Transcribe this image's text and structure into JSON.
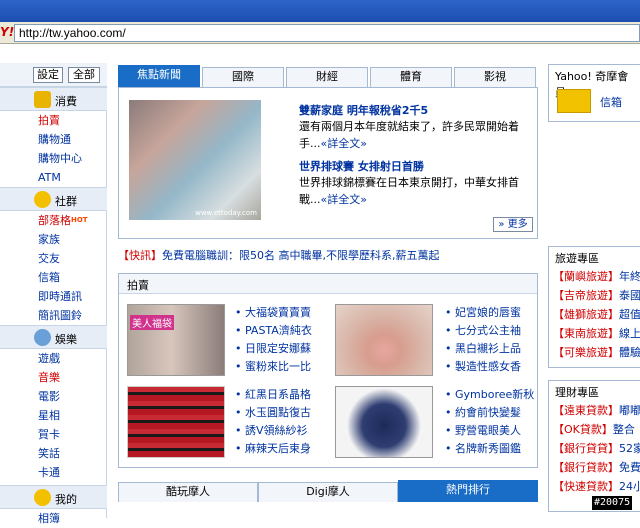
{
  "browser": {
    "logo": "Y!",
    "url": "http://tw.yahoo.com/"
  },
  "sidebar": {
    "settings_label": "設定",
    "all_label": "全部",
    "categories": [
      {
        "title": "消費",
        "items": [
          "拍賣",
          "購物通",
          "購物中心",
          "ATM"
        ]
      },
      {
        "title": "社群",
        "items": [
          "部落格",
          "家族",
          "交友",
          "信箱",
          "即時通訊",
          "簡訊圖鈴"
        ],
        "hot": "HOT"
      },
      {
        "title": "娛樂",
        "items": [
          "遊戲",
          "音樂",
          "電影",
          "星相",
          "賀卡",
          "笑話",
          "卡通"
        ]
      },
      {
        "title": "我的",
        "items": [
          "相簿"
        ]
      }
    ]
  },
  "tabs": [
    "焦點新聞",
    "國際",
    "財經",
    "體育",
    "影視"
  ],
  "news": {
    "image_caption": "www.ettoday.com",
    "items": [
      {
        "title": "雙薪家庭 明年報稅省2千5",
        "summary": "還有兩個月本年度就結束了，許多民眾開始着手...",
        "more": "«詳全文»"
      },
      {
        "title": "世界排球賽 女排射日首勝",
        "summary": "世界排球錦標賽在日本東京開打，中華女排首戰...",
        "more": "«詳全文»"
      }
    ],
    "more_button": "» 更多"
  },
  "ticker": {
    "tag": "【快訊】",
    "text": "免費電腦職訓：限50名 高中職畢,不限學歷科系,薪五萬起"
  },
  "auction": {
    "title": "拍賣",
    "banner_text": "美人福袋",
    "groups": [
      [
        "大福袋賣賣賣",
        "PASTA濟純衣",
        "日限定安娜蘇",
        "蜜粉來比一比"
      ],
      [
        "妃宮娘的唇蜜",
        "七分式公主袖",
        "黑白襯衫上品",
        "製造性感女香"
      ],
      [
        "紅黑日系晶格",
        "水玉圓點復古",
        "誘V領絲紗衫",
        "麻辣天后束身"
      ],
      [
        "Gymboree新秋",
        "約會前快變髮",
        "野營電眼美人",
        "名牌新秀圖鑑"
      ]
    ]
  },
  "bottom_tabs": [
    "酷玩摩人",
    "Digi摩人",
    "熱門排行"
  ],
  "right": {
    "member_title": "Yahoo! 奇摩會員",
    "mail_label": "信箱",
    "travel_title": "旅遊專區",
    "travel_items": [
      {
        "tag": "【蘭嶼旅遊】",
        "text": "年終"
      },
      {
        "tag": "【吉帝旅遊】",
        "text": "泰國"
      },
      {
        "tag": "【雄獅旅遊】",
        "text": "超值"
      },
      {
        "tag": "【東南旅遊】",
        "text": "線上"
      },
      {
        "tag": "【可樂旅遊】",
        "text": "體驗"
      }
    ],
    "finance_title": "理財專區",
    "finance_items": [
      {
        "tag": "【遠東貸款】",
        "text": "嘟嘟"
      },
      {
        "tag": "【OK貸款】",
        "text": "整合"
      },
      {
        "tag": "【銀行貸貸】",
        "text": "52家"
      },
      {
        "tag": "【銀行貸款】",
        "text": "免費"
      },
      {
        "tag": "【快速貸款】",
        "text": "24小"
      }
    ]
  },
  "watermark": "#20075"
}
